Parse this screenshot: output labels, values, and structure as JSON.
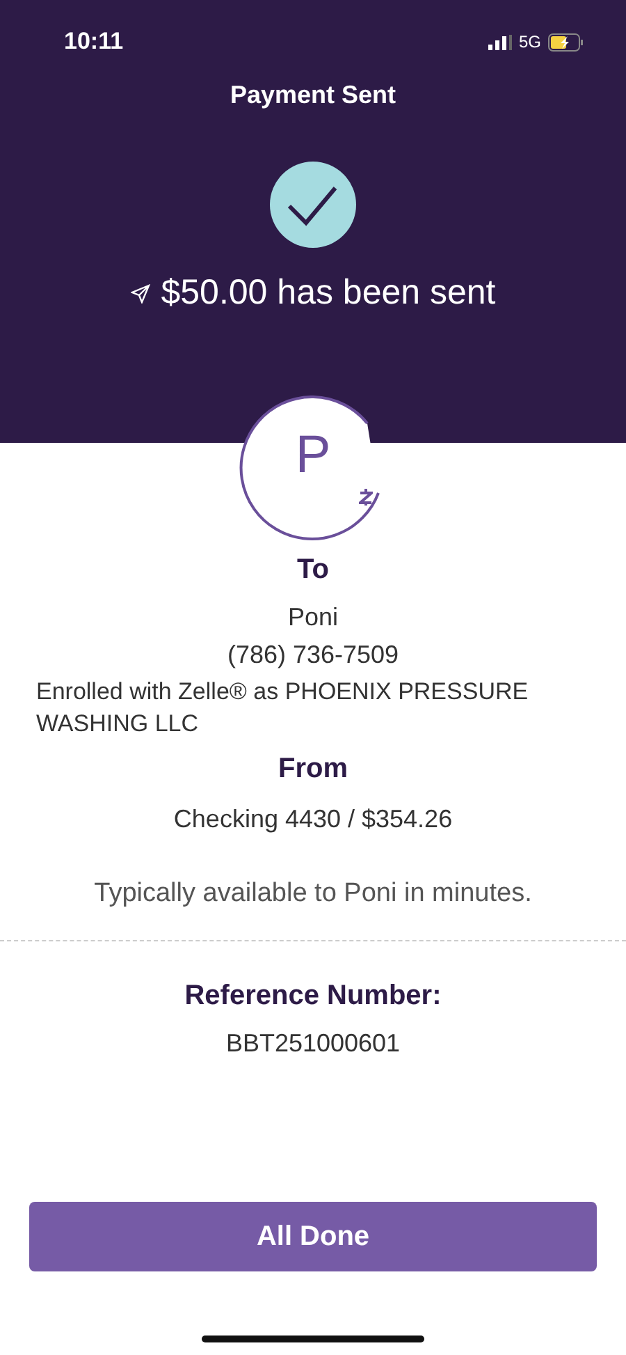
{
  "status_bar": {
    "time": "10:11",
    "network": "5G"
  },
  "header": {
    "title": "Payment Sent",
    "amount_message": "$50.00 has been sent"
  },
  "recipient": {
    "initial": "P",
    "heading": "To",
    "name": "Poni",
    "phone": "(786) 736-7509",
    "enrollment": "Enrolled with Zelle® as PHOENIX PRESSURE WASHING LLC"
  },
  "source": {
    "heading": "From",
    "account": "Checking 4430 / $354.26"
  },
  "availability": "Typically available to Poni in minutes.",
  "reference": {
    "label": "Reference Number:",
    "number": "BBT251000601"
  },
  "done_button": "All Done"
}
